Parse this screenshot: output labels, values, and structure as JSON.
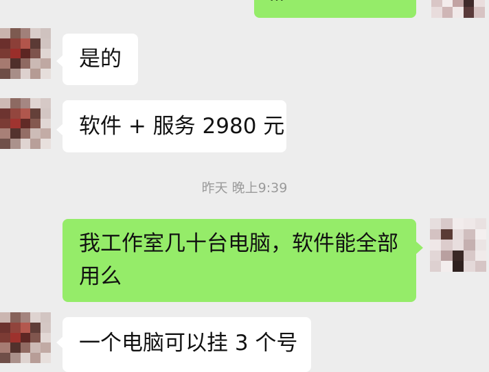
{
  "chat": {
    "timestamp": "昨天 晚上9:39",
    "messages": [
      {
        "direction": "out",
        "text": "…"
      },
      {
        "direction": "in",
        "text": "是的"
      },
      {
        "direction": "in",
        "text": "软件 + 服务 2980 元"
      },
      {
        "direction": "out",
        "text": "我工作室几十台电脑，软件能全部用么"
      },
      {
        "direction": "in",
        "text": "一个电脑可以挂 3 个号"
      }
    ]
  },
  "colors": {
    "background": "#ededed",
    "incoming_bubble": "#ffffff",
    "outgoing_bubble": "#95ec69",
    "timestamp_text": "#9a9a9a"
  }
}
